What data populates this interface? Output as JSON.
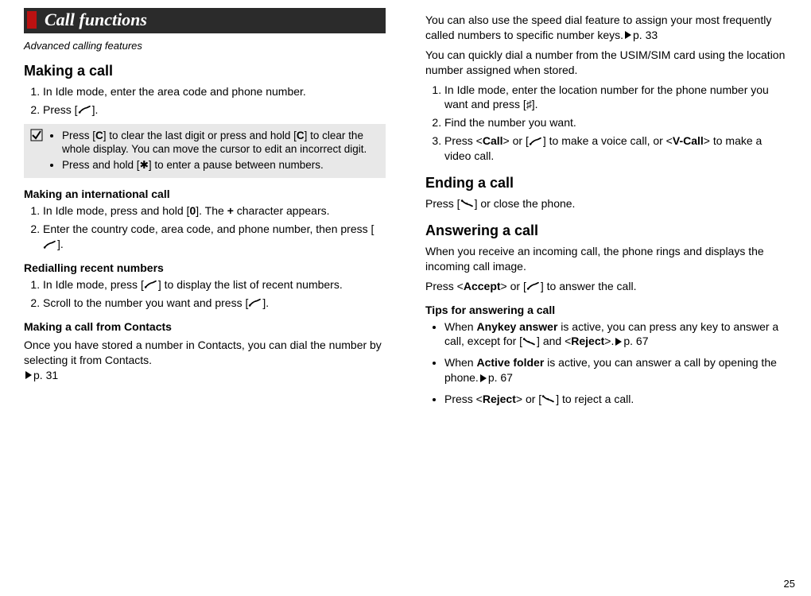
{
  "header": {
    "title": "Call functions"
  },
  "subtitle": "Advanced calling features",
  "left": {
    "topic1": "Making a call",
    "list1": [
      "In Idle mode, enter the area code and phone number.",
      "Press [CALL_ICON]."
    ],
    "tip1": "Press [",
    "tip1b": "] to clear the last digit or press and hold [",
    "tip1c": "] to clear the whole display. You can move the cursor to edit an incorrect digit.",
    "tip1_key": "C",
    "tip2a": "Press and hold [",
    "tip2b": "] to enter a pause between numbers.",
    "tip2_key": "✱",
    "sub1": "Making an international call",
    "list2_a": "In Idle mode, press and hold [",
    "list2_key": "0",
    "list2_b": "]. The ",
    "list2_plus": "+",
    "list2_c": " character appears.",
    "list2_2": "Enter the country code, area code, and phone number, then press [CALL_ICON].",
    "sub2": "Redialling recent numbers",
    "list3_1": "In Idle mode, press [CALL_ICON] to display the list of recent numbers.",
    "list3_2": "Scroll to the number you want and press [CALL_ICON].",
    "sub3": "Making a call from Contacts",
    "p3": "Once you have stored a number in Contacts, you can dial the number by selecting it from Contacts.",
    "p3_ref": "p. 31"
  },
  "right": {
    "p1": "You can also use the speed dial feature to assign your most frequently called numbers to specific number keys.",
    "p1_ref": "p. 33",
    "p2": "You can quickly dial a number from the USIM/SIM card using the location number assigned when stored.",
    "listA_1a": "In Idle mode, enter the location number for the phone number you want and press [",
    "listA_1key": "♯",
    "listA_1b": "].",
    "listA_2": "Find the number you want.",
    "listA_3a": "Press <",
    "listA_3call": "Call",
    "listA_3b": "> or [CALL_ICON] to make a voice call, or <",
    "listA_3vcall": "V-Call",
    "listA_3c": "> to make a video call.",
    "topic2": "Ending a call",
    "p3": "Press [END_ICON] or close the phone.",
    "topic3": "Answering a call",
    "p4": "When you receive an incoming call, the phone rings and displays the incoming call image.",
    "p5a": "Press <",
    "p5accept": "Accept",
    "p5b": "> or [CALL_ICON] to answer the call.",
    "sub4": "Tips for answering a call",
    "tipA_a": "When ",
    "tipA_bold": "Anykey answer",
    "tipA_b": " is active, you can press any key to answer a call, except for [END_ICON] and <",
    "tipA_reject": "Reject",
    "tipA_c": ">.",
    "tipA_ref": "p. 67",
    "tipB_a": "When ",
    "tipB_bold": "Active folder",
    "tipB_b": " is active, you can answer a call by opening the phone.",
    "tipB_ref": "p. 67",
    "tipC_a": "Press <",
    "tipC_reject": "Reject",
    "tipC_b": "> or [END_ICON] to reject a call."
  },
  "page_number": "25"
}
